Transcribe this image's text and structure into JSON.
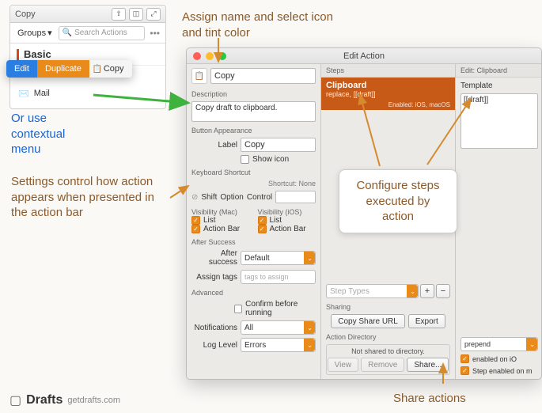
{
  "sidebar": {
    "title": "Copy",
    "groups_label": "Groups",
    "search_placeholder": "Search Actions",
    "group_name": "Basic",
    "items": [
      {
        "label": "Copy"
      },
      {
        "label": "Mail"
      }
    ]
  },
  "context_menu": {
    "edit": "Edit",
    "duplicate": "Duplicate",
    "copy": "Copy"
  },
  "editor": {
    "window_title": "Edit Action",
    "name_value": "Copy",
    "description_label": "Description",
    "description_value": "Copy draft to clipboard.",
    "button_appearance_label": "Button Appearance",
    "label_label": "Label",
    "label_value": "Copy",
    "show_icon_label": "Show icon",
    "keyboard_shortcut_label": "Keyboard Shortcut",
    "shortcut_value": "Shortcut: None",
    "mods": {
      "shift": "Shift",
      "option": "Option",
      "control": "Control"
    },
    "visibility_mac_label": "Visibility (Mac)",
    "visibility_ios_label": "Visibility (iOS)",
    "list_label": "List",
    "action_bar_label": "Action Bar",
    "after_success_label": "After Success",
    "after_success_row": "After success",
    "after_success_value": "Default",
    "assign_tags_label": "Assign tags",
    "assign_tags_placeholder": "tags to assign",
    "advanced_label": "Advanced",
    "confirm_label": "Confirm before running",
    "notifications_label": "Notifications",
    "notifications_value": "All",
    "log_level_label": "Log Level",
    "log_level_value": "Errors",
    "steps_head": "Steps",
    "step_name": "Clipboard",
    "step_sub": "replace, [[draft]]",
    "step_enabled": "Enabled: iOS, macOS",
    "step_types_placeholder": "Step Types",
    "sharing_label": "Sharing",
    "copy_share_url": "Copy Share URL",
    "export": "Export",
    "action_directory_label": "Action Directory",
    "not_shared": "Not shared to directory.",
    "view": "View",
    "remove": "Remove",
    "share": "Share...",
    "edit_head": "Edit: Clipboard",
    "template_label": "Template",
    "template_value": "[[draft]]",
    "prepend": "prepend",
    "enabled_ios": "enabled on iO",
    "enabled_mac": "Step enabled on m"
  },
  "annotations": {
    "assign": "Assign name and select icon and tint color",
    "contextual": "Or use contextual menu",
    "settings": "Settings control how action appears when presented in the action bar",
    "configure": "Configure steps executed by action",
    "share": "Share actions"
  },
  "footer": {
    "brand": "Drafts",
    "url": "getdrafts.com"
  }
}
